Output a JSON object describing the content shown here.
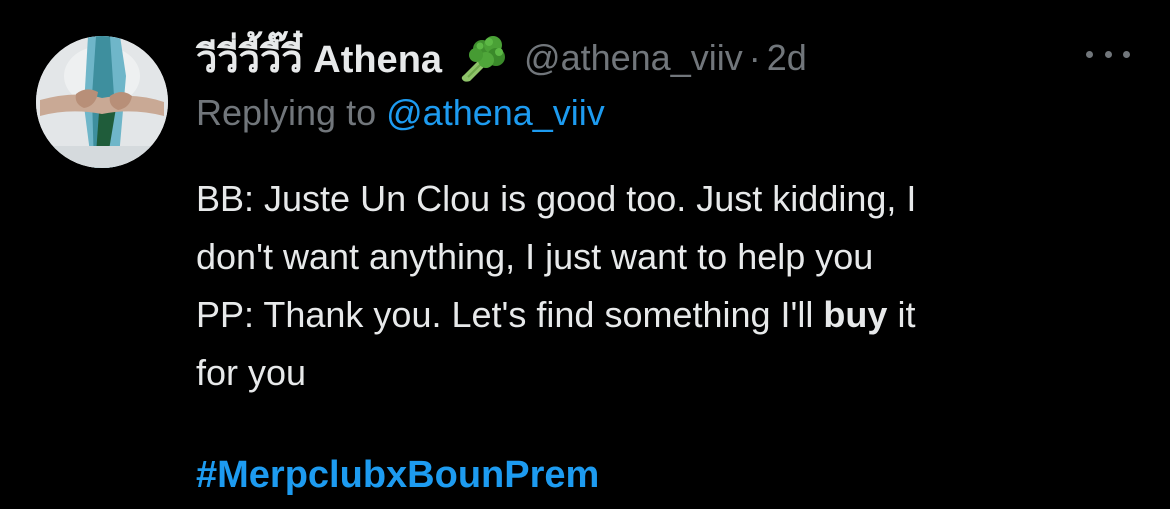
{
  "tweet": {
    "display_name": "วีวี่วี้วี๊วี๋ Athena",
    "name_emoji_icon": "broccoli-icon",
    "handle": "@athena_viiv",
    "separator": "·",
    "time": "2d",
    "more_icon": "ellipsis-icon",
    "replying_prefix": "Replying to",
    "replying_mention": "@athena_viiv",
    "body_lines": [
      "BB: Juste Un Clou is good too. Just kidding, I",
      "don't want anything, I just want to help you",
      "PP: Thank you. Let's find something I'll ",
      "buy",
      " it",
      "for you"
    ],
    "hashtag": "#MerpclubxBounPrem"
  },
  "colors": {
    "background": "#000000",
    "text_primary": "#e7e9ea",
    "text_secondary": "#71767b",
    "link": "#1d9bf0"
  }
}
